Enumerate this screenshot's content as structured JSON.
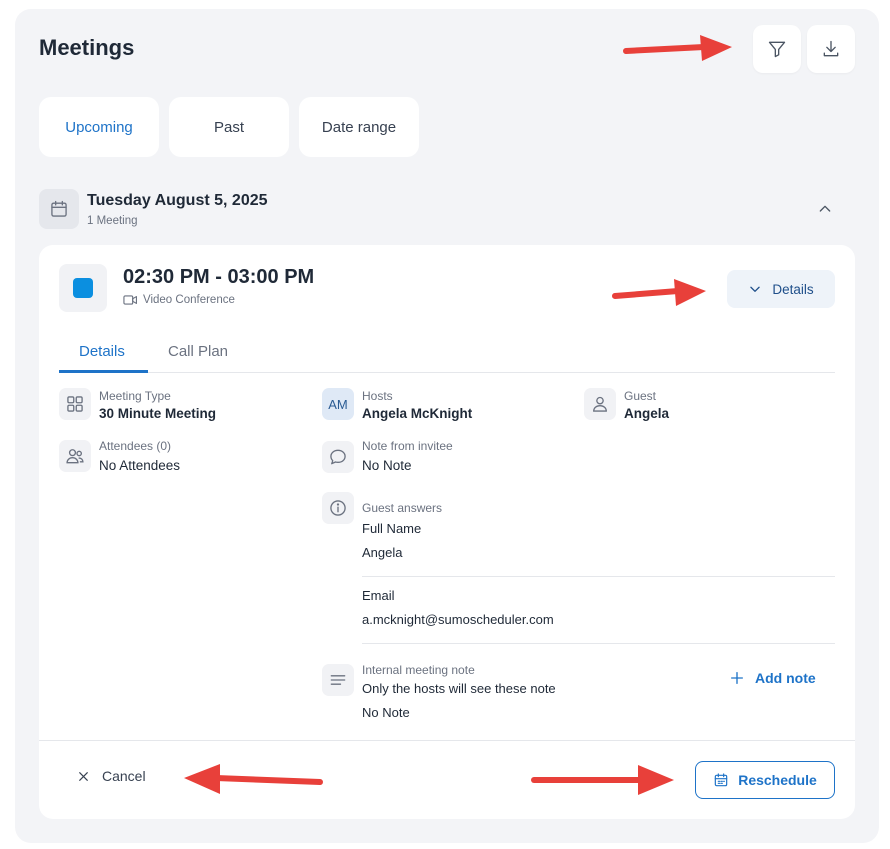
{
  "header": {
    "title": "Meetings",
    "filter_icon": "filter-icon",
    "download_icon": "download-icon"
  },
  "tabs": [
    {
      "label": "Upcoming",
      "active": true
    },
    {
      "label": "Past",
      "active": false
    },
    {
      "label": "Date range",
      "active": false
    }
  ],
  "date_group": {
    "title": "Tuesday August 5, 2025",
    "subtitle": "1 Meeting",
    "icon": "calendar-icon",
    "collapse_icon": "chevron-up-icon"
  },
  "meeting": {
    "color": "#0b8fe0",
    "time_range": "02:30 PM - 03:00 PM",
    "location": "Video Conference",
    "details_button": "Details",
    "tabs": [
      {
        "label": "Details",
        "active": true
      },
      {
        "label": "Call Plan",
        "active": false
      }
    ],
    "meeting_type": {
      "label": "Meeting Type",
      "value": "30 Minute Meeting"
    },
    "attendees": {
      "label": "Attendees (0)",
      "value": "No Attendees"
    },
    "hosts": {
      "label": "Hosts",
      "initials": "AM",
      "value": "Angela McKnight"
    },
    "guest": {
      "label": "Guest",
      "value": "Angela"
    },
    "note_from_invitee": {
      "label": "Note from invitee",
      "value": "No Note"
    },
    "guest_answers": {
      "label": "Guest answers",
      "items": [
        {
          "question": "Full Name",
          "answer": "Angela"
        },
        {
          "question": "Email",
          "answer": "a.mcknight@sumoscheduler.com"
        }
      ]
    },
    "internal_note": {
      "label": "Internal meeting note",
      "hint": "Only the hosts will see these note",
      "value": "No Note",
      "add_label": "Add note"
    }
  },
  "footer": {
    "cancel_label": "Cancel",
    "reschedule_label": "Reschedule"
  },
  "colors": {
    "accent": "#1e73c8",
    "annotation_arrow": "#e8403a",
    "panel_bg": "#f3f4f7"
  }
}
